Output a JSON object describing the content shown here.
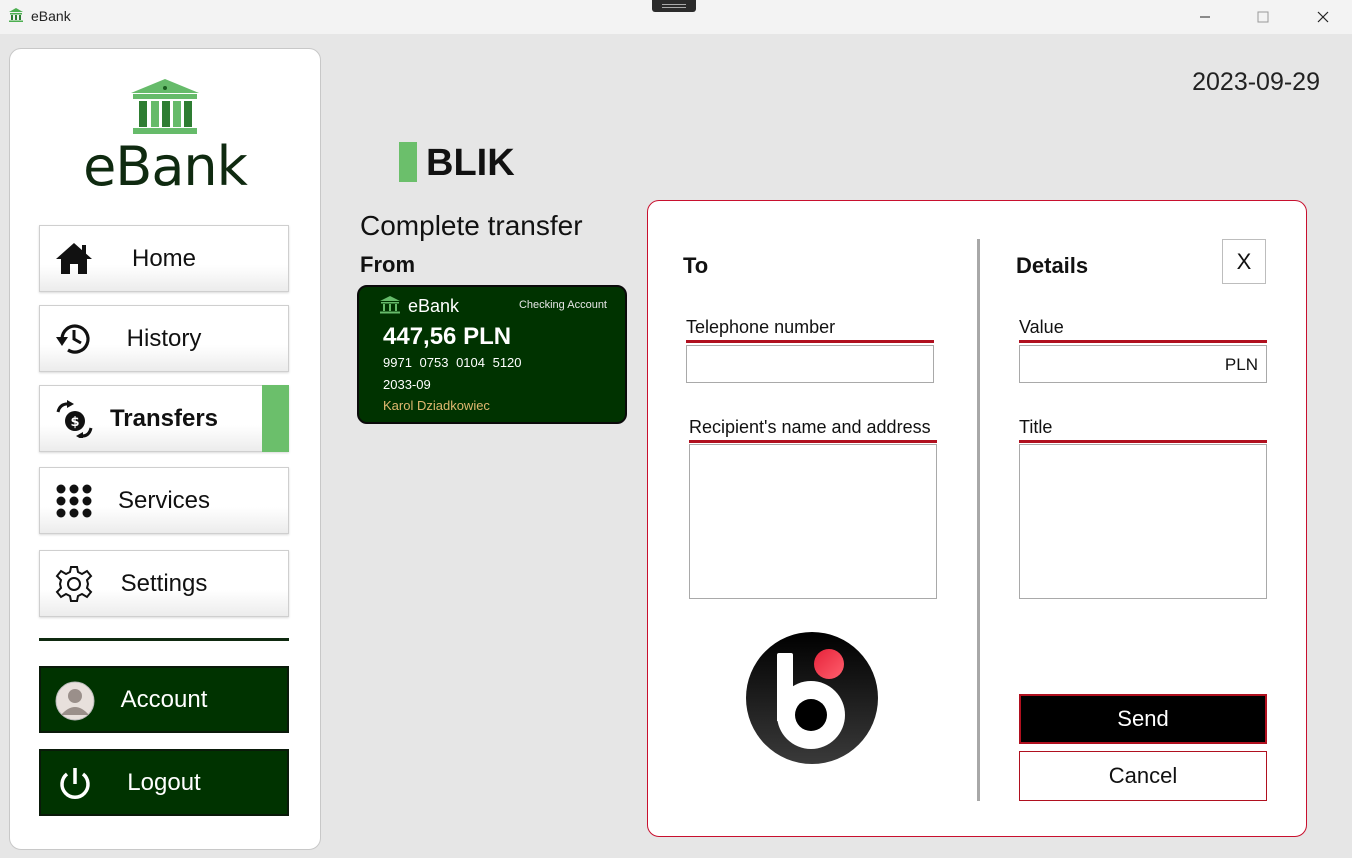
{
  "window": {
    "title": "eBank",
    "minimize_glyph": "—",
    "close_glyph": "✕"
  },
  "sidebar": {
    "logo_text": "eBank",
    "items": [
      {
        "label": "Home",
        "icon": "home-icon"
      },
      {
        "label": "History",
        "icon": "history-icon"
      },
      {
        "label": "Transfers",
        "icon": "transfers-icon",
        "active": true
      },
      {
        "label": "Services",
        "icon": "services-grid-icon"
      },
      {
        "label": "Settings",
        "icon": "gear-icon"
      }
    ],
    "account_label": "Account",
    "logout_label": "Logout"
  },
  "header": {
    "date": "2023-09-29",
    "section_title": "BLIK",
    "subtitle": "Complete transfer",
    "from_label": "From"
  },
  "card": {
    "bank": "eBank",
    "type": "Checking Account",
    "balance": "447,56 PLN",
    "number": "9971 0753 0104 5120",
    "expiry": "2033-09",
    "holder": "Karol Dziadkowiec"
  },
  "form": {
    "to_heading": "To",
    "details_heading": "Details",
    "close_label": "X",
    "phone_label": "Telephone number",
    "phone_value": "",
    "recipient_label": "Recipient's name and address",
    "recipient_value": "",
    "value_label": "Value",
    "value_value": "",
    "value_unit": "PLN",
    "title_label": "Title",
    "title_value": "",
    "send_label": "Send",
    "cancel_label": "Cancel"
  },
  "colors": {
    "accent_green": "#6bbf6b",
    "dark_green": "#003300",
    "border_red": "#c8102e"
  }
}
